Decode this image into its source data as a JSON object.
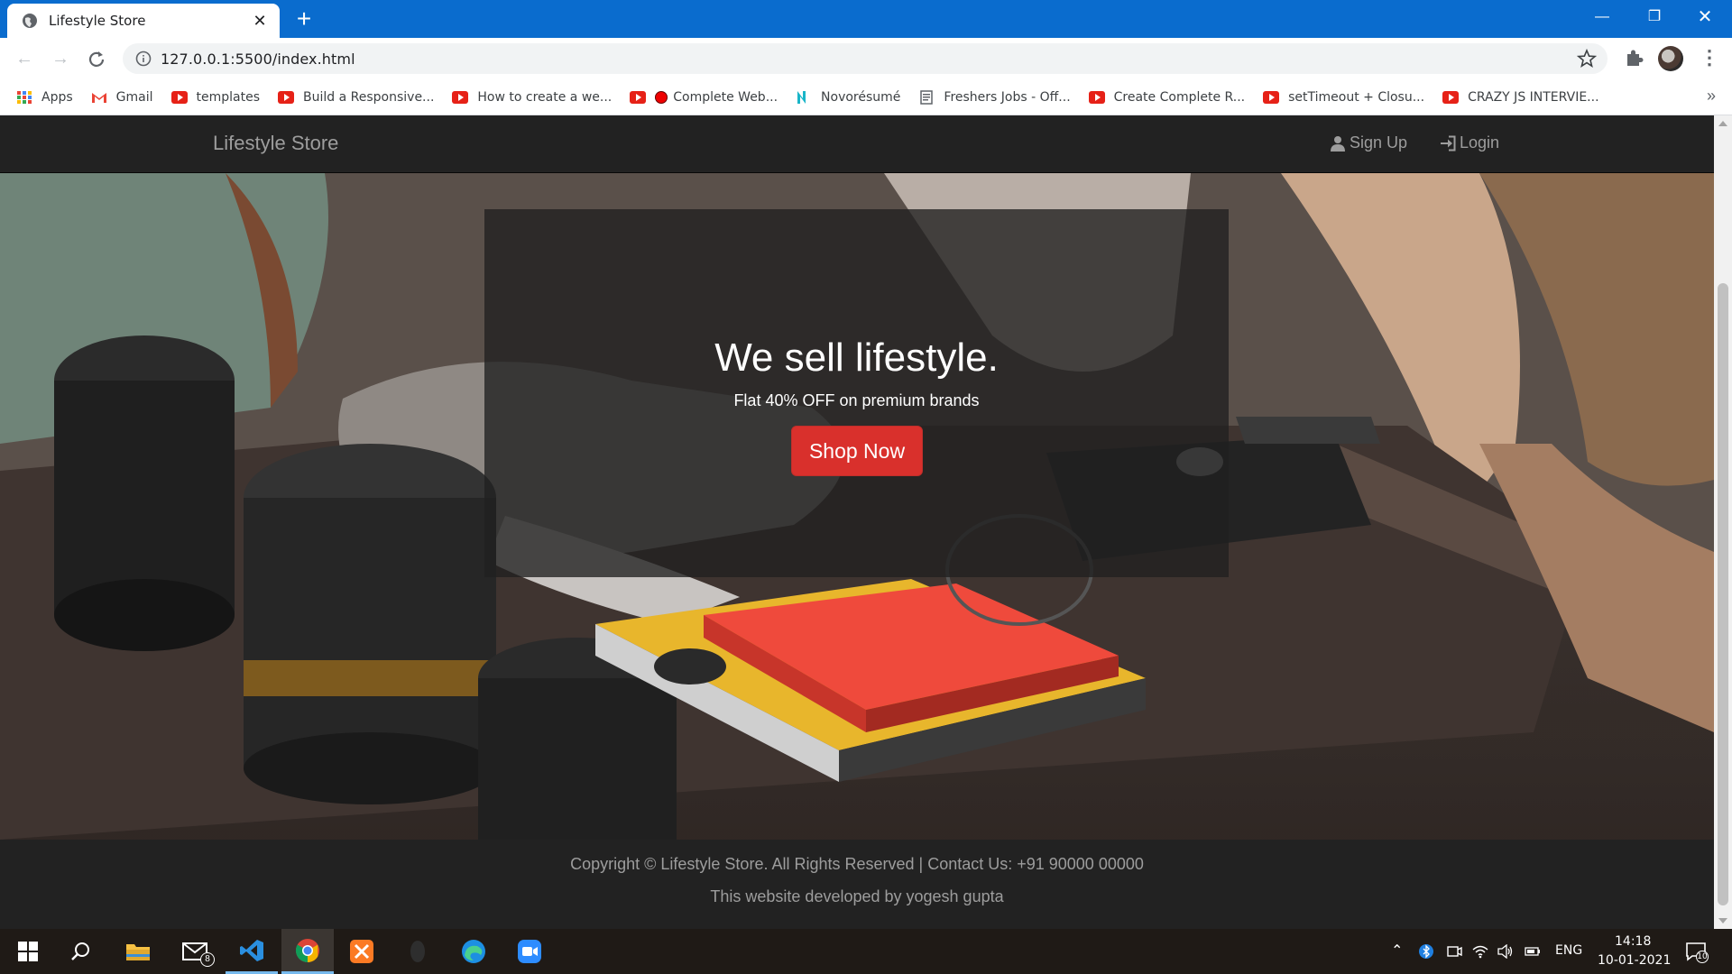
{
  "browser": {
    "tab_title": "Lifestyle Store",
    "url": "127.0.0.1:5500/index.html",
    "bookmarks": [
      {
        "label": "Apps",
        "icon": "apps-grid-icon"
      },
      {
        "label": "Gmail",
        "icon": "gmail-icon"
      },
      {
        "label": "templates",
        "icon": "youtube-icon"
      },
      {
        "label": "Build a Responsive...",
        "icon": "youtube-icon"
      },
      {
        "label": "How to create a we...",
        "icon": "youtube-icon"
      },
      {
        "label": "Complete Web...",
        "icon": "youtube-icon"
      },
      {
        "label": "Novorésumé",
        "icon": "novoresume-icon"
      },
      {
        "label": "Freshers Jobs - Off...",
        "icon": "page-icon"
      },
      {
        "label": "Create Complete R...",
        "icon": "youtube-icon"
      },
      {
        "label": "setTimeout + Closu...",
        "icon": "youtube-icon"
      },
      {
        "label": "CRAZY JS INTERVIE...",
        "icon": "youtube-icon"
      }
    ]
  },
  "site": {
    "brand": "Lifestyle Store",
    "nav": {
      "signup": "Sign Up",
      "login": "Login"
    },
    "hero": {
      "title": "We sell lifestyle.",
      "subtitle": "Flat 40% OFF on premium brands",
      "cta": "Shop Now"
    },
    "footer": {
      "line1": "Copyright © Lifestyle Store. All Rights Reserved | Contact Us: +91 90000 00000",
      "line2": "This website developed by yogesh gupta"
    },
    "colors": {
      "navbar": "#222222",
      "cta": "#d9302c",
      "tabstrip": "#0a6cce"
    }
  },
  "taskbar": {
    "mail_badge": "8",
    "language": "ENG",
    "time": "14:18",
    "date": "10-01-2021",
    "notification_count": "10"
  }
}
